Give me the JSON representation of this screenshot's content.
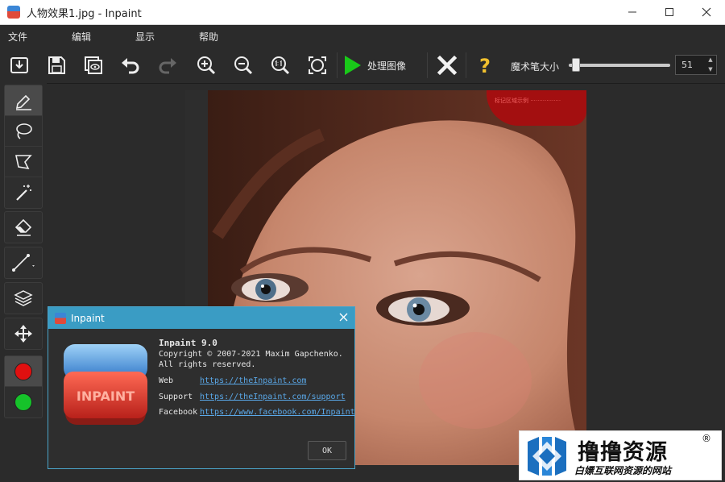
{
  "window": {
    "title": "人物效果1.jpg - Inpaint"
  },
  "menu": {
    "items": [
      "文件",
      "编辑",
      "显示",
      "帮助"
    ]
  },
  "toolbar": {
    "process_label": "处理图像",
    "brush_size_label": "魔术笔大小",
    "brush_size_value": "51",
    "brush_size_level": 0.06,
    "colors": {
      "play": "#19c919",
      "help": "#f2c12e"
    }
  },
  "tools": {
    "marker_colors": {
      "red": "#e01010",
      "green": "#16c22a"
    }
  },
  "canvas": {
    "watermark_text": "标记区域示例 ·················"
  },
  "about_dialog": {
    "title": "Inpaint",
    "product": "Inpaint 9.0",
    "copyright_line1": "Copyright © 2007-2021 Maxim Gapchenko.",
    "copyright_line2": "All rights reserved.",
    "web_label": "Web",
    "web_link": "https://theInpaint.com",
    "support_label": "Support",
    "support_link": "https://theInpaint.com/support",
    "facebook_label": "Facebook",
    "facebook_link": "https://www.facebook.com/Inpaint",
    "ok_label": "OK",
    "logo_text": "INPAINT"
  },
  "brand": {
    "name": "撸撸资源",
    "registered": "®",
    "tagline": "白嫖互联网资源的网站"
  }
}
